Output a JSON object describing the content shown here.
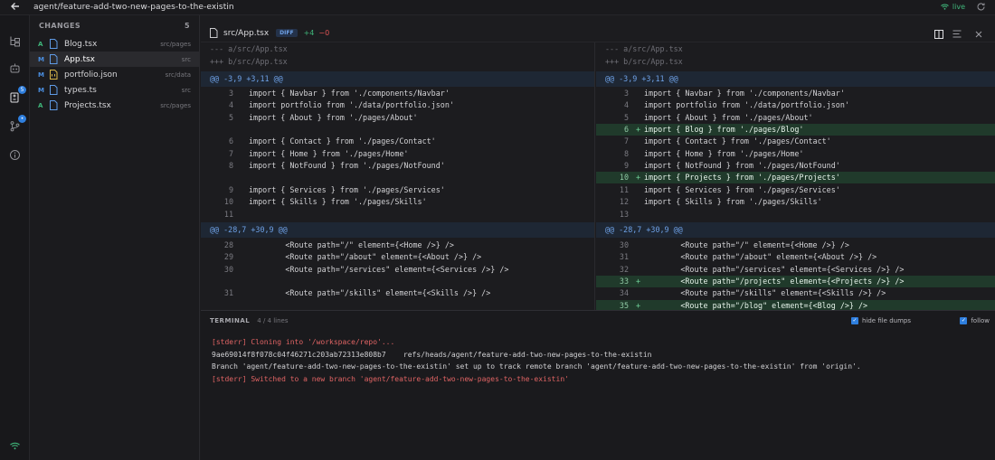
{
  "header": {
    "branch": "agent/feature-add-two-new-pages-to-the-existin",
    "live_label": "live"
  },
  "rail": {
    "badges": {
      "changes": "5",
      "git": "•"
    }
  },
  "changes": {
    "title": "CHANGES",
    "count": "5",
    "files": [
      {
        "status": "A",
        "name": "Blog.tsx",
        "dir": "src/pages",
        "icon": "file-icon"
      },
      {
        "status": "M",
        "name": "App.tsx",
        "dir": "src",
        "icon": "file-icon",
        "selected": true
      },
      {
        "status": "M",
        "name": "portfolio.json",
        "dir": "src/data",
        "icon": "json-file-icon"
      },
      {
        "status": "M",
        "name": "types.ts",
        "dir": "src",
        "icon": "file-icon"
      },
      {
        "status": "A",
        "name": "Projects.tsx",
        "dir": "src/pages",
        "icon": "file-icon"
      }
    ]
  },
  "diff": {
    "filename": "src/App.tsx",
    "badge": "DIFF",
    "additions": "+4",
    "deletions": "−0",
    "left": {
      "meta_a": "--- a/src/App.tsx",
      "meta_b": "+++ b/src/App.tsx",
      "hunk1": "@@ -3,9 +3,11 @@",
      "lines1": [
        {
          "n": "3",
          "code": "import { Navbar } from './components/Navbar'"
        },
        {
          "n": "4",
          "code": "import portfolio from './data/portfolio.json'"
        },
        {
          "n": "5",
          "code": "import { About } from './pages/About'"
        },
        {
          "n": "",
          "code": ""
        },
        {
          "n": "6",
          "code": "import { Contact } from './pages/Contact'"
        },
        {
          "n": "7",
          "code": "import { Home } from './pages/Home'"
        },
        {
          "n": "8",
          "code": "import { NotFound } from './pages/NotFound'"
        },
        {
          "n": "",
          "code": ""
        },
        {
          "n": "9",
          "code": "import { Services } from './pages/Services'"
        },
        {
          "n": "10",
          "code": "import { Skills } from './pages/Skills'"
        },
        {
          "n": "11",
          "code": ""
        }
      ],
      "hunk2": "@@ -28,7 +30,9 @@",
      "lines2": [
        {
          "n": "28",
          "code": "        <Route path=\"/\" element={<Home />} />"
        },
        {
          "n": "29",
          "code": "        <Route path=\"/about\" element={<About />} />"
        },
        {
          "n": "30",
          "code": "        <Route path=\"/services\" element={<Services />} />"
        },
        {
          "n": "",
          "code": ""
        },
        {
          "n": "31",
          "code": "        <Route path=\"/skills\" element={<Skills />} />"
        },
        {
          "n": "",
          "code": ""
        }
      ]
    },
    "right": {
      "meta_a": "--- a/src/App.tsx",
      "meta_b": "+++ b/src/App.tsx",
      "hunk1": "@@ -3,9 +3,11 @@",
      "lines1": [
        {
          "n": "3",
          "code": "import { Navbar } from './components/Navbar'"
        },
        {
          "n": "4",
          "code": "import portfolio from './data/portfolio.json'"
        },
        {
          "n": "5",
          "code": "import { About } from './pages/About'"
        },
        {
          "n": "6",
          "code": "import { Blog } from './pages/Blog'",
          "added": true
        },
        {
          "n": "7",
          "code": "import { Contact } from './pages/Contact'"
        },
        {
          "n": "8",
          "code": "import { Home } from './pages/Home'"
        },
        {
          "n": "9",
          "code": "import { NotFound } from './pages/NotFound'"
        },
        {
          "n": "10",
          "code": "import { Projects } from './pages/Projects'",
          "added": true
        },
        {
          "n": "11",
          "code": "import { Services } from './pages/Services'"
        },
        {
          "n": "12",
          "code": "import { Skills } from './pages/Skills'"
        },
        {
          "n": "13",
          "code": ""
        }
      ],
      "hunk2": "@@ -28,7 +30,9 @@",
      "lines2": [
        {
          "n": "30",
          "code": "        <Route path=\"/\" element={<Home />} />"
        },
        {
          "n": "31",
          "code": "        <Route path=\"/about\" element={<About />} />"
        },
        {
          "n": "32",
          "code": "        <Route path=\"/services\" element={<Services />} />"
        },
        {
          "n": "33",
          "code": "        <Route path=\"/projects\" element={<Projects />} />",
          "added": true
        },
        {
          "n": "34",
          "code": "        <Route path=\"/skills\" element={<Skills />} />"
        },
        {
          "n": "35",
          "code": "        <Route path=\"/blog\" element={<Blog />} />",
          "added": true
        }
      ]
    }
  },
  "terminal": {
    "title": "TERMINAL",
    "count": "4 / 4 lines",
    "hide_dumps_label": "hide file dumps",
    "follow_label": "follow",
    "lines": [
      {
        "text": "[stderr] Cloning into '/workspace/repo'...",
        "err": true
      },
      {
        "text": "9ae69014f8f078c04f46271c203ab72313e808b7    refs/heads/agent/feature-add-two-new-pages-to-the-existin",
        "err": false
      },
      {
        "text": "Branch 'agent/feature-add-two-new-pages-to-the-existin' set up to track remote branch 'agent/feature-add-two-new-pages-to-the-existin' from 'origin'.",
        "err": false
      },
      {
        "text": "[stderr] Switched to a new branch 'agent/feature-add-two-new-pages-to-the-existin'",
        "err": true
      }
    ]
  },
  "colors": {
    "accent": "#2f7fde",
    "added": "#3fb67a",
    "removed": "#e05454",
    "error": "#e06464"
  }
}
